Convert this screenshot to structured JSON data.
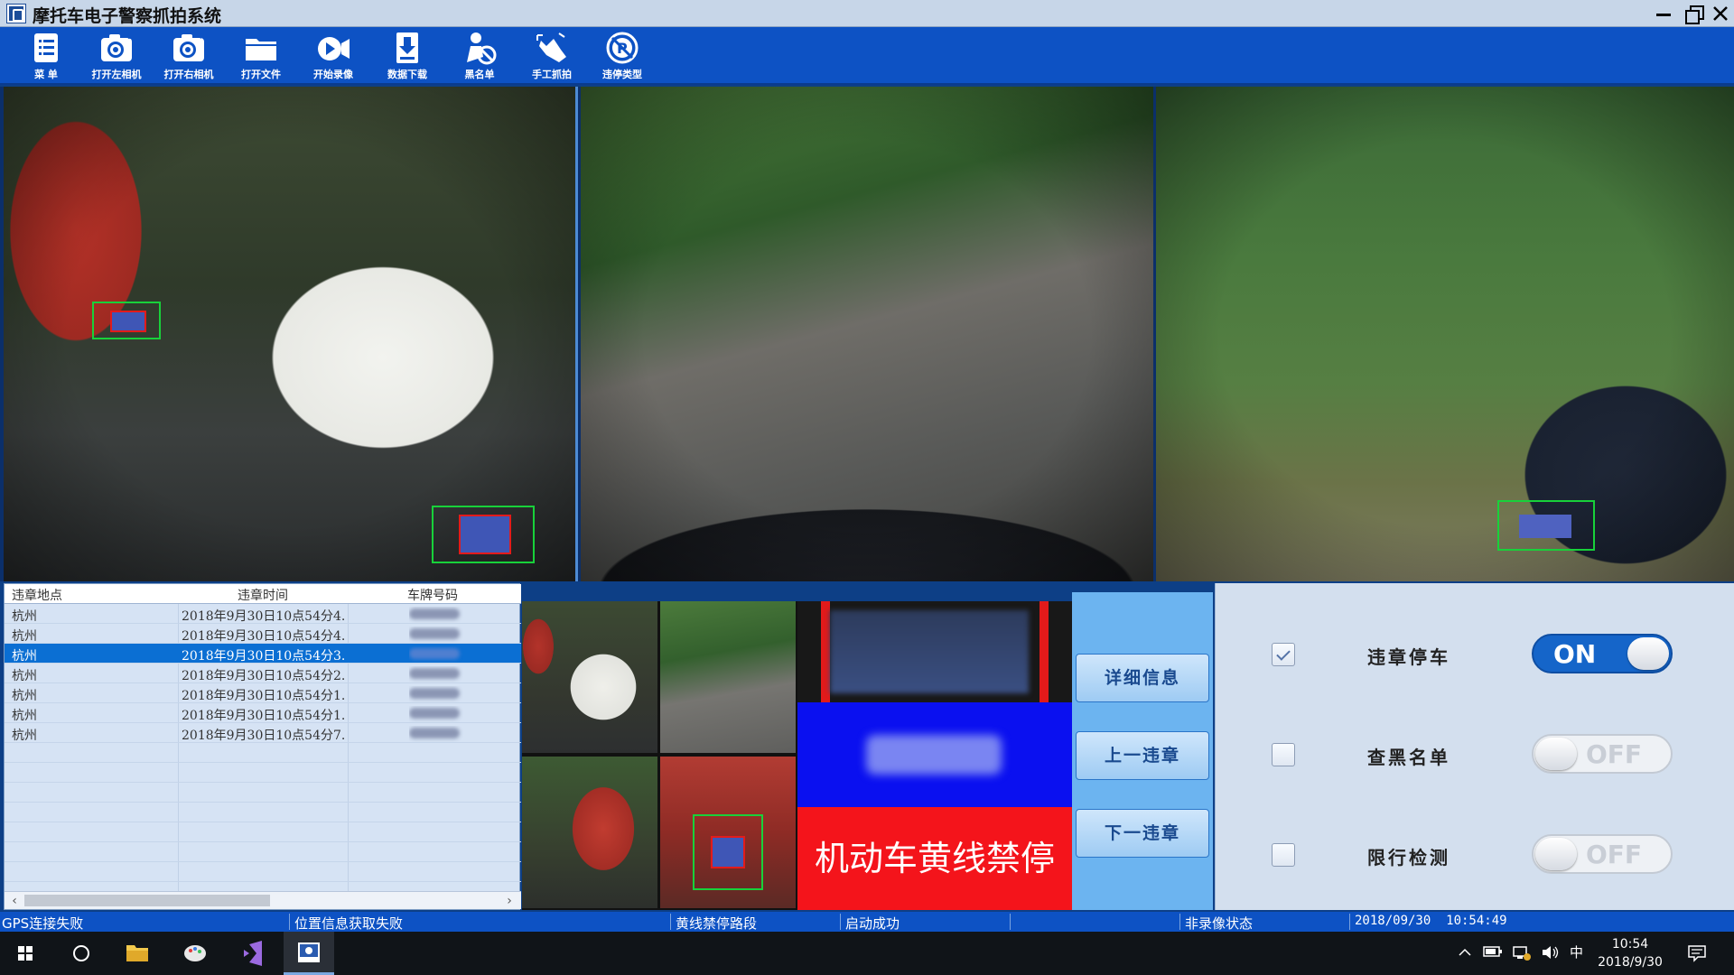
{
  "window": {
    "title": "摩托车电子警察抓拍系统"
  },
  "toolbar": [
    {
      "label": "菜 单",
      "icon": "menu-list-icon"
    },
    {
      "label": "打开左相机",
      "icon": "camera-left-icon"
    },
    {
      "label": "打开右相机",
      "icon": "camera-right-icon"
    },
    {
      "label": "打开文件",
      "icon": "folder-icon"
    },
    {
      "label": "开始录像",
      "icon": "video-record-icon"
    },
    {
      "label": "数据下载",
      "icon": "download-icon"
    },
    {
      "label": "黑名单",
      "icon": "blacklist-icon"
    },
    {
      "label": "手工抓拍",
      "icon": "manual-capture-icon"
    },
    {
      "label": "违停类型",
      "icon": "no-parking-type-icon"
    }
  ],
  "table": {
    "headers": [
      "违章地点",
      "违章时间",
      "车牌号码"
    ],
    "rows": [
      {
        "location": "杭州",
        "time": "2018年9月30日10点54分4...",
        "selected": false
      },
      {
        "location": "杭州",
        "time": "2018年9月30日10点54分4...",
        "selected": false
      },
      {
        "location": "杭州",
        "time": "2018年9月30日10点54分3...",
        "selected": true
      },
      {
        "location": "杭州",
        "time": "2018年9月30日10点54分2...",
        "selected": false
      },
      {
        "location": "杭州",
        "time": "2018年9月30日10点54分1...",
        "selected": false
      },
      {
        "location": "杭州",
        "time": "2018年9月30日10点54分1...",
        "selected": false
      },
      {
        "location": "杭州",
        "time": "2018年9月30日10点54分7...",
        "selected": false
      }
    ]
  },
  "violation": {
    "type_label": "机动车黄线禁停"
  },
  "actions": {
    "detail": "详细信息",
    "prev": "上一违章",
    "next": "下一违章"
  },
  "controls": [
    {
      "label": "违章停车",
      "checked": true,
      "state": "ON"
    },
    {
      "label": "查黑名单",
      "checked": false,
      "state": "OFF"
    },
    {
      "label": "限行检测",
      "checked": false,
      "state": "OFF"
    }
  ],
  "status": {
    "gps": "GPS连接失败",
    "location": "位置信息获取失败",
    "road": "黄线禁停路段",
    "startup": "启动成功",
    "record": "非录像状态",
    "datetime": "2018/09/30  10:54:49"
  },
  "taskbar": {
    "ime": "中",
    "time": "10:54",
    "date": "2018/9/30"
  },
  "colors": {
    "toolbar": "#0d52c4",
    "violation_red": "#f4141b",
    "plate_blue": "#0a10f0",
    "toggle_on": "#1565c9"
  }
}
